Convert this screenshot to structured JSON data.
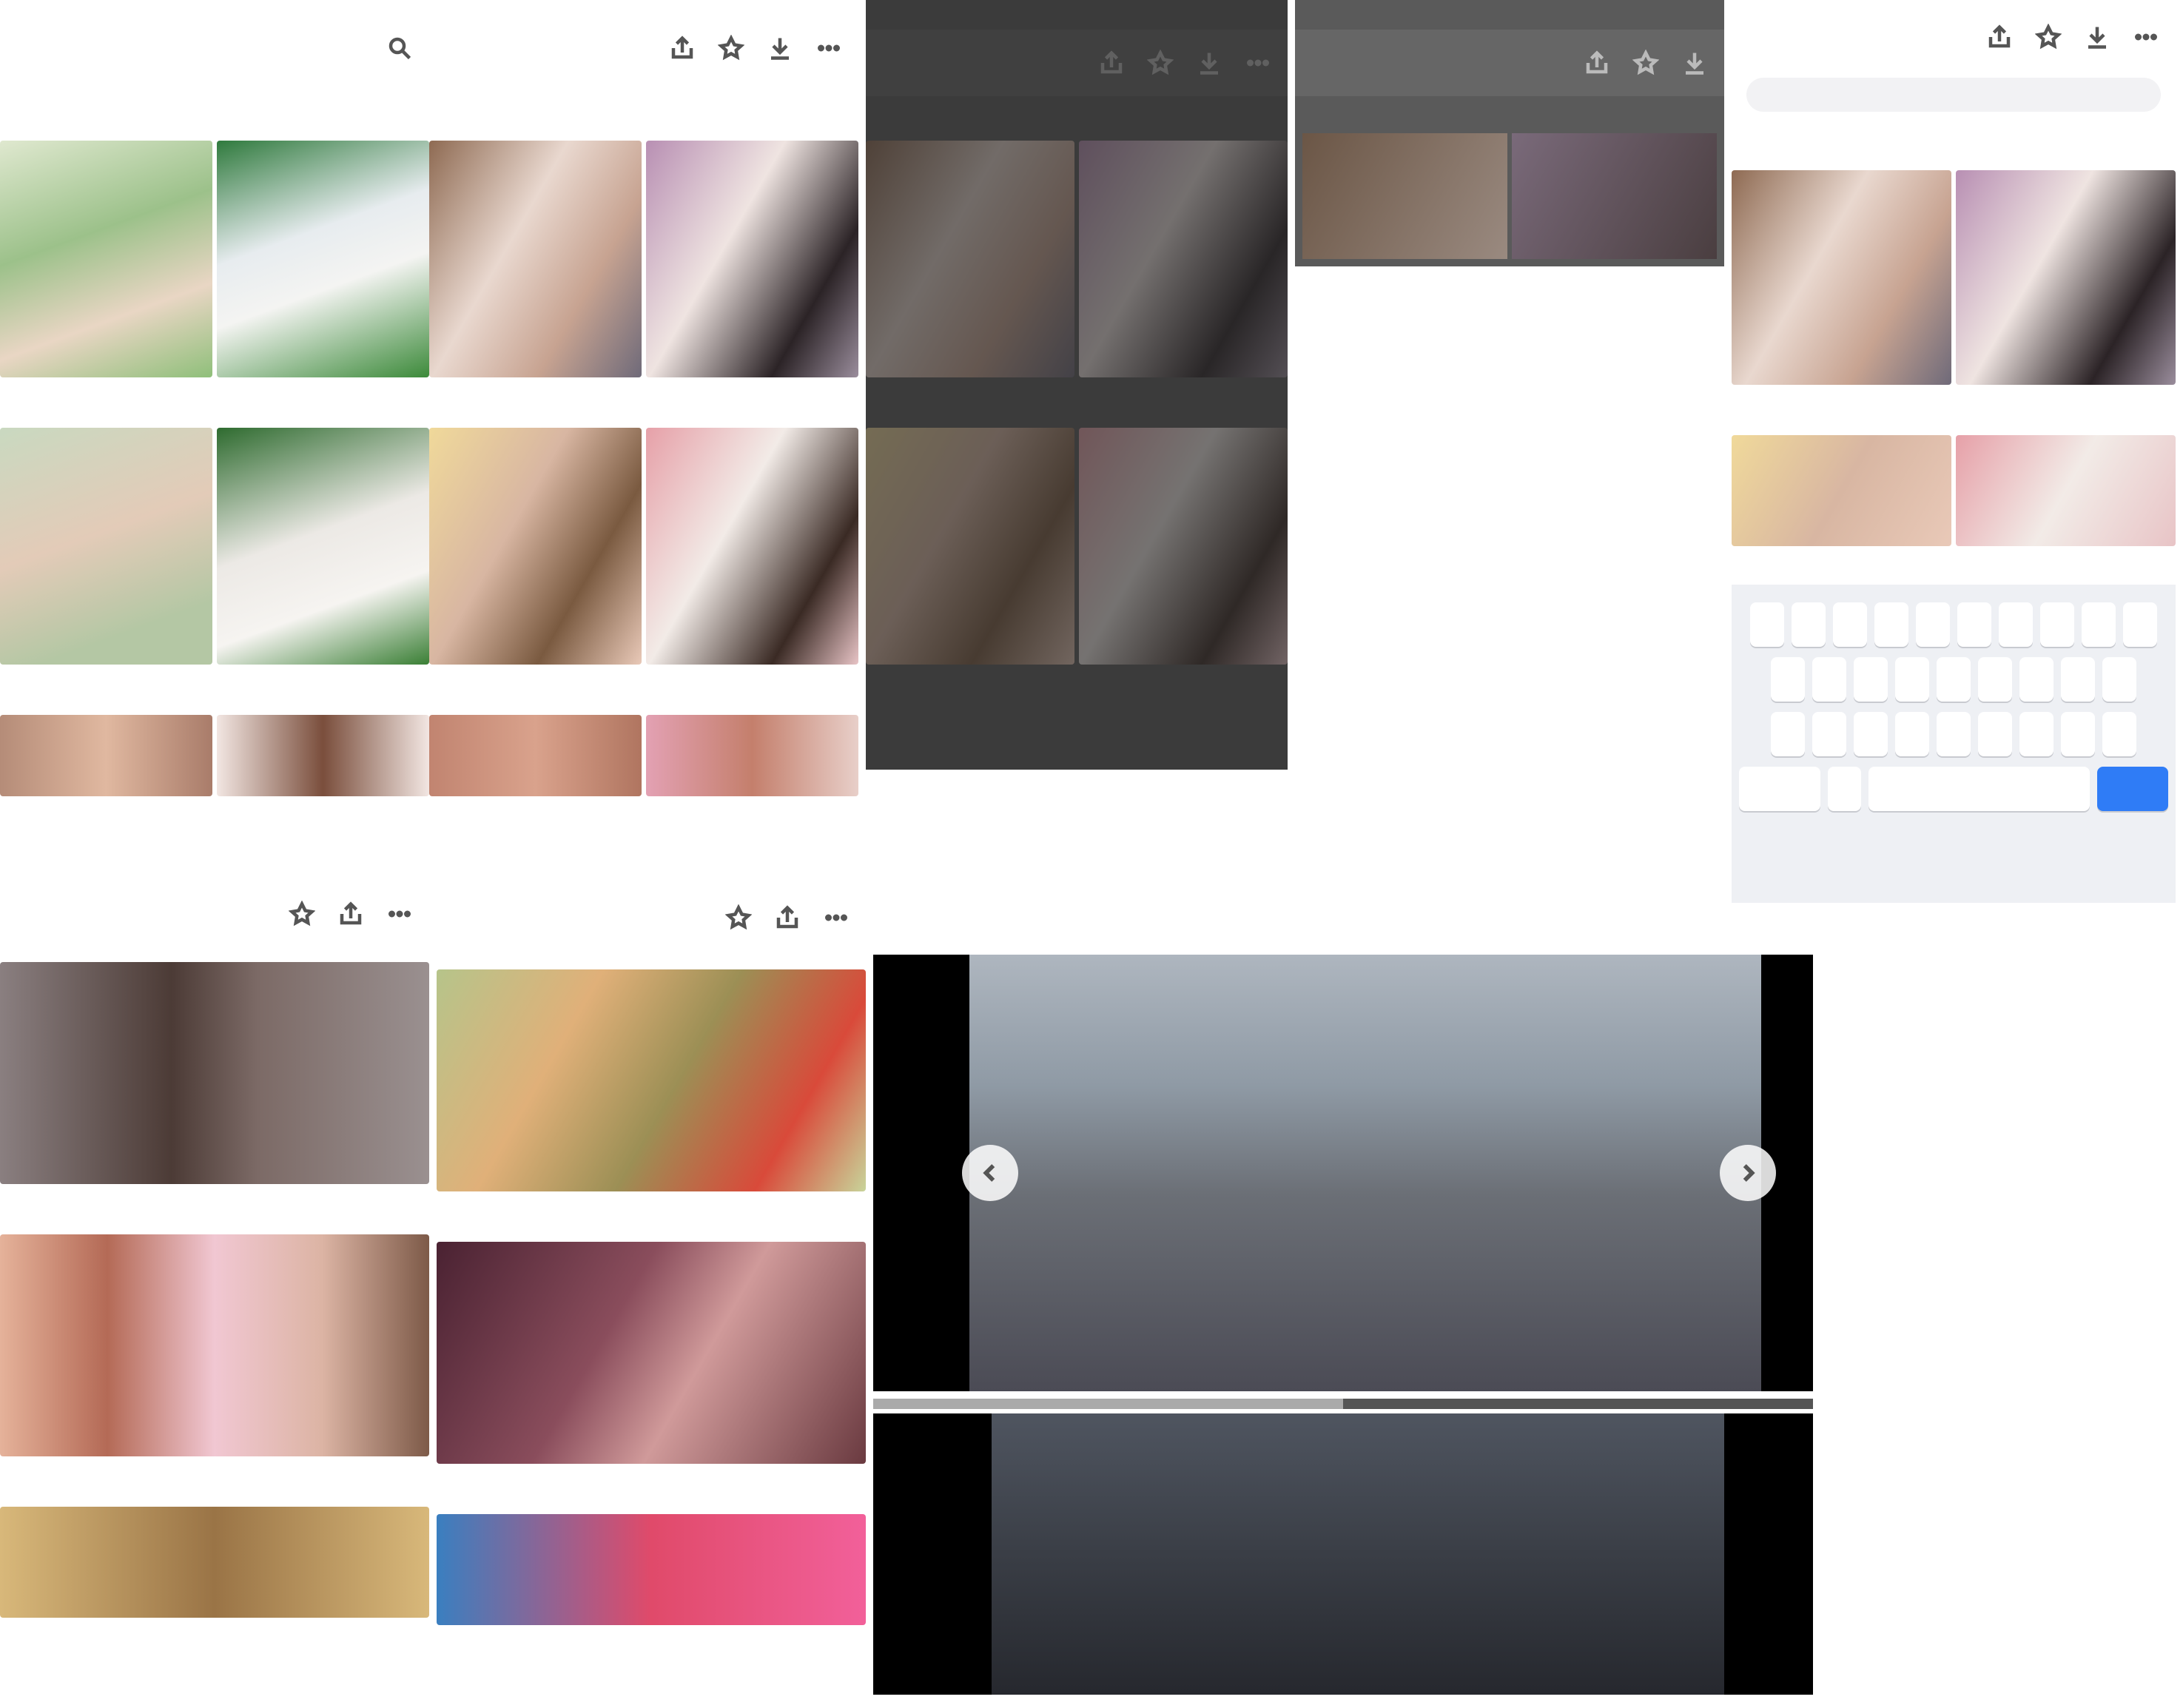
{
  "panel1": {
    "title": "",
    "tabs": [
      "",
      ""
    ]
  },
  "panel2": {
    "title": "",
    "tabs": [
      "",
      ""
    ]
  },
  "panel3": {
    "title": ""
  },
  "panel4": {
    "title": "",
    "list": [
      "",
      "",
      "",
      "",
      "",
      "",
      "",
      "",
      "",
      "",
      "",
      "",
      "",
      "",
      "",
      "",
      ""
    ]
  },
  "panel5": {
    "title": "",
    "search_placeholder": ""
  },
  "panel6": {
    "title": ""
  },
  "panel7": {
    "title": ""
  },
  "video": {
    "progress": 0.5
  },
  "colors": {
    "accent": "#e45",
    "keyboard_go": "#2f7cf6",
    "overlay": "#282828"
  },
  "icons": [
    "search-icon",
    "share-icon",
    "star-icon",
    "download-icon",
    "more-icon",
    "chevron-left-icon",
    "chevron-right-icon"
  ]
}
